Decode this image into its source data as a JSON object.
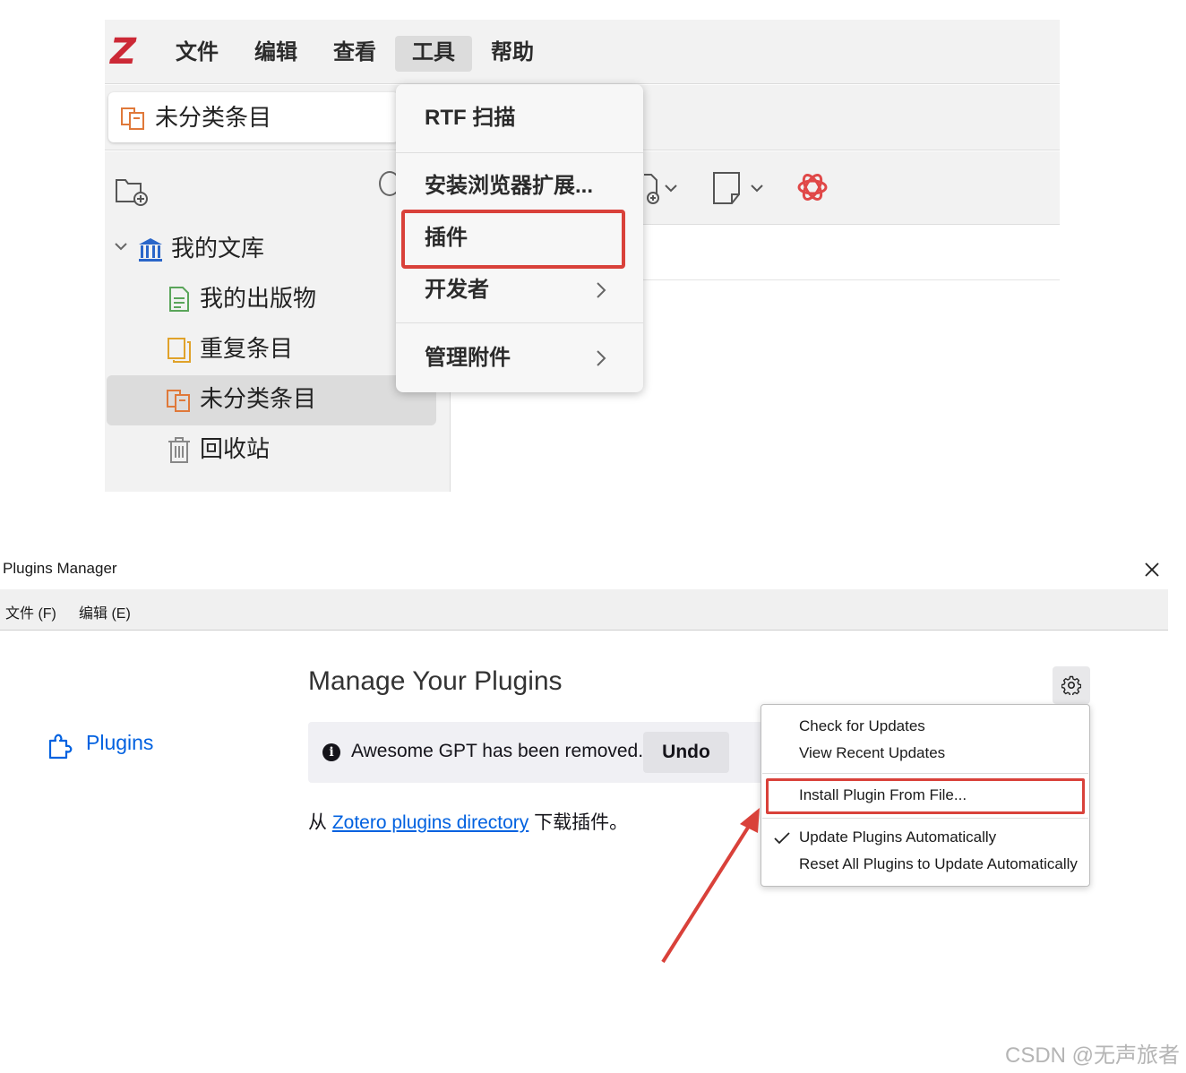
{
  "zotero": {
    "logo": "Z",
    "menubar": [
      {
        "label": "文件",
        "active": false
      },
      {
        "label": "编辑",
        "active": false
      },
      {
        "label": "查看",
        "active": false
      },
      {
        "label": "工具",
        "active": true
      },
      {
        "label": "帮助",
        "active": false
      }
    ],
    "collection_header": {
      "label": "未分类条目",
      "icon": "unfiled-items-icon"
    },
    "tree": {
      "library": {
        "label": "我的文库",
        "icon": "library-icon",
        "expanded": true
      },
      "items": [
        {
          "label": "我的出版物",
          "icon": "publications-icon",
          "selected": false
        },
        {
          "label": "重复条目",
          "icon": "duplicates-icon",
          "selected": false
        },
        {
          "label": "未分类条目",
          "icon": "unfiled-items-icon",
          "selected": true
        },
        {
          "label": "回收站",
          "icon": "trash-icon",
          "selected": false
        }
      ]
    },
    "tools_menu": {
      "items": [
        {
          "label": "RTF 扫描",
          "submenu": false
        },
        {
          "label": "安装浏览器扩展...",
          "submenu": false
        },
        {
          "label": "插件",
          "submenu": false,
          "highlighted": true
        },
        {
          "label": "开发者",
          "submenu": true
        },
        {
          "label": "管理附件",
          "submenu": true
        }
      ]
    },
    "toolbar_icons": [
      "add-attachment-icon",
      "new-note-icon",
      "chatgpt-icon"
    ],
    "highlight_color": "#d9413a"
  },
  "plugins_manager": {
    "title": "Plugins Manager",
    "menubar": [
      {
        "label": "文件 (F)"
      },
      {
        "label": "编辑 (E)"
      }
    ],
    "sidebar": {
      "label": "Plugins",
      "icon": "puzzle-piece-icon"
    },
    "heading": "Manage Your Plugins",
    "notice": {
      "text": "Awesome GPT has been removed.",
      "undo_label": "Undo",
      "icon": "info-icon"
    },
    "directory": {
      "prefix": "从 ",
      "link": "Zotero plugins directory",
      "suffix": " 下载插件。"
    },
    "gear_menu": {
      "items": [
        {
          "label": "Check for Updates",
          "checked": false
        },
        {
          "label": "View Recent Updates",
          "checked": false
        },
        {
          "label": "Install Plugin From File...",
          "checked": false,
          "highlighted": true
        },
        {
          "label": "Update Plugins Automatically",
          "checked": true
        },
        {
          "label": "Reset All Plugins to Update Automatically",
          "checked": false
        }
      ]
    },
    "link_color": "#0061e0"
  },
  "watermark": "CSDN @无声旅者"
}
